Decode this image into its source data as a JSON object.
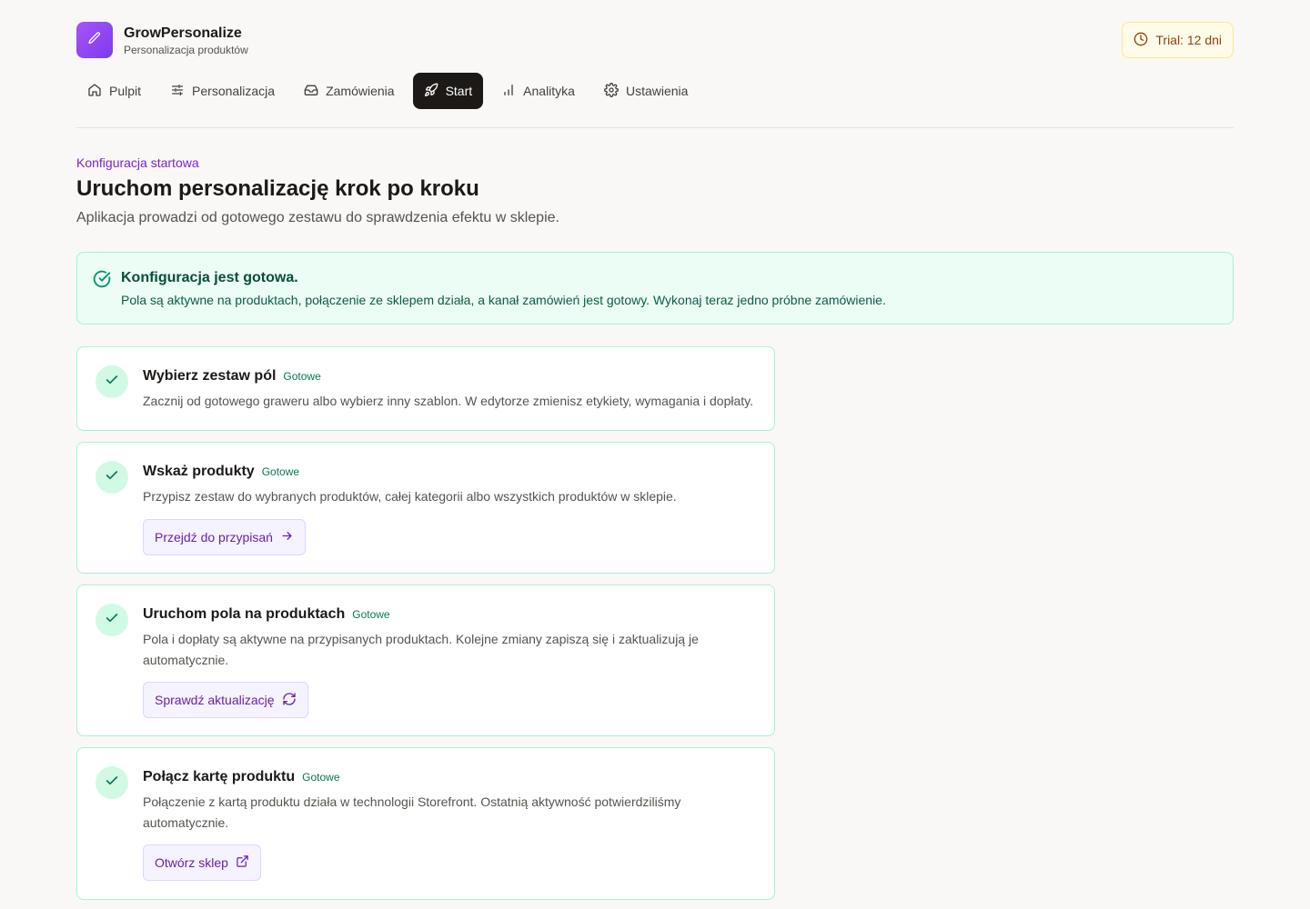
{
  "app": {
    "name": "GrowPersonalize",
    "subtitle": "Personalizacja produktów",
    "logo_icon": "pen-icon",
    "accent": "#7c3aed"
  },
  "trial": {
    "label": "Trial: 12 dni",
    "icon": "clock-icon"
  },
  "nav": {
    "items": [
      {
        "label": "Pulpit",
        "icon": "home-icon",
        "active": false
      },
      {
        "label": "Personalizacja",
        "icon": "sliders-icon",
        "active": false
      },
      {
        "label": "Zamówienia",
        "icon": "inbox-icon",
        "active": false
      },
      {
        "label": "Start",
        "icon": "rocket-icon",
        "active": true
      },
      {
        "label": "Analityka",
        "icon": "bar-chart-icon",
        "active": false
      },
      {
        "label": "Ustawienia",
        "icon": "gear-icon",
        "active": false
      }
    ]
  },
  "page": {
    "eyebrow": "Konfiguracja startowa",
    "title": "Uruchom personalizację krok po kroku",
    "subtitle": "Aplikacja prowadzi od gotowego zestawu do sprawdzenia efektu w sklepie."
  },
  "banner": {
    "title": "Konfiguracja jest gotowa.",
    "text": "Pola są aktywne na produktach, połączenie ze sklepem działa, a kanał zamówień jest gotowy. Wykonaj teraz jedno próbne zamówienie.",
    "color": "#059669"
  },
  "steps": [
    {
      "title": "Wybierz zestaw pól",
      "status": "Gotowe",
      "description": "Zacznij od gotowego graweru albo wybierz inny szablon. W edytorze zmienisz etykiety, wymagania i dopłaty."
    },
    {
      "title": "Wskaż produkty",
      "status": "Gotowe",
      "description": "Przypisz zestaw do wybranych produktów, całej kategorii albo wszystkich produktów w sklepie.",
      "action": "Przejdź do przypisań",
      "action_icon": "arrow-right-icon"
    },
    {
      "title": "Uruchom pola na produktach",
      "status": "Gotowe",
      "description": "Pola i dopłaty są aktywne na przypisanych produktach. Kolejne zmiany zapiszą się i zaktualizują je automatycznie.",
      "action": "Sprawdź aktualizację",
      "action_icon": "refresh-icon"
    },
    {
      "title": "Połącz kartę produktu",
      "status": "Gotowe",
      "description": "Połączenie z kartą produktu działa w technologii Storefront. Ostatnią aktywność potwierdziliśmy automatycznie.",
      "action": "Otwórz sklep",
      "action_icon": "external-link-icon"
    }
  ]
}
